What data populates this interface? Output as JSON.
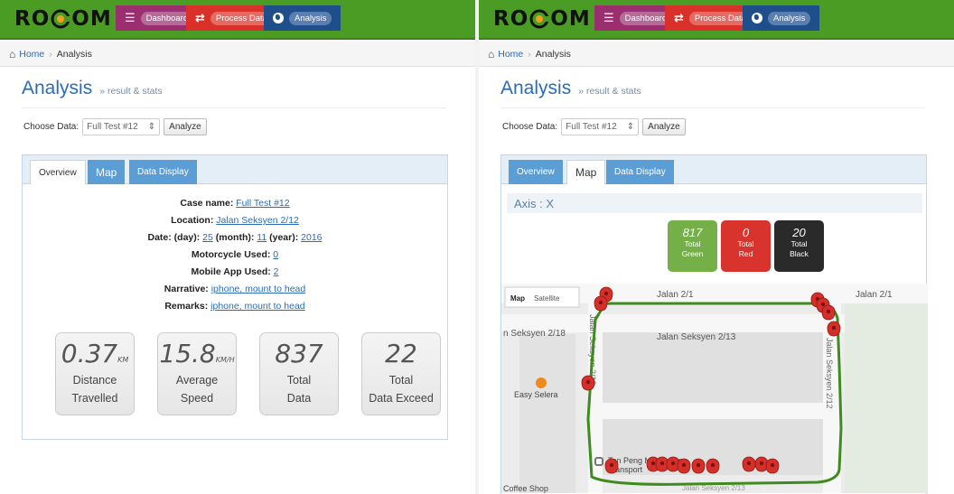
{
  "nav": {
    "logo": "ROCOM",
    "dashboard": "Dashboard",
    "process_data": "Process Data",
    "analysis": "Analysis"
  },
  "breadcrumb": {
    "home": "Home",
    "current": "Analysis"
  },
  "header": {
    "title": "Analysis",
    "subtitle": "» result & stats"
  },
  "choose": {
    "label": "Choose Data:",
    "selected": "Full Test #12",
    "button": "Analyze"
  },
  "tabs": {
    "overview": "Overview",
    "map": "Map",
    "data_display": "Data Display"
  },
  "overview": {
    "case_name_label": "Case name:",
    "case_name": "Full Test #12",
    "location_label": "Location:",
    "location": "Jalan Seksyen 2/12",
    "date_day_label": "Date: (day):",
    "day": "25",
    "month_label": "(month):",
    "month": "11",
    "year_label": "(year):",
    "year": "2016",
    "motorcycle_label": "Motorcycle Used:",
    "motorcycle": "0",
    "mobile_label": "Mobile App Used:",
    "mobile": "2",
    "narrative_label": "Narrative:",
    "narrative": "iphone, mount to head",
    "remarks_label": "Remarks:",
    "remarks": "iphone, mount to head"
  },
  "stats": [
    {
      "value": "0.37",
      "unit": "KM",
      "line1": "Distance",
      "line2": "Travelled"
    },
    {
      "value": "15.8",
      "unit": "KM/H",
      "line1": "Average",
      "line2": "Speed"
    },
    {
      "value": "837",
      "unit": "",
      "line1": "Total",
      "line2": "Data"
    },
    {
      "value": "22",
      "unit": "",
      "line1": "Total",
      "line2": "Data Exceed"
    }
  ],
  "map_view": {
    "axis": "Axis : X",
    "counts": [
      {
        "value": "817",
        "line1": "Total",
        "line2": "Green"
      },
      {
        "value": "0",
        "line1": "Total",
        "line2": "Red"
      },
      {
        "value": "20",
        "line1": "Total",
        "line2": "Black"
      }
    ],
    "map_type": "Map",
    "satellite": "Satellite",
    "streets": {
      "jalan_2_1": "Jalan 2/1",
      "seksyen_2_18": "n Seksyen 2/18",
      "seksyen_2_13": "Jalan Seksyen 2/13",
      "seksyen_2_12": "Jalan Seksyen 2/12",
      "seksyen_2_12_right": "Jalan Seksyen 2/12",
      "bottom_partial": "Jalan Seksyen 2/13"
    },
    "places": {
      "easy_selera": "Easy Selera",
      "tan_peng": "Tan Peng Min Trading",
      "tan_peng_2": "Transport",
      "coffee_shop": "Coffee Shop"
    }
  },
  "colors": {
    "navbar": "#4b9c24",
    "accent": "#2a6db6",
    "route": "#3e8c1d",
    "marker": "#d62f2a"
  }
}
